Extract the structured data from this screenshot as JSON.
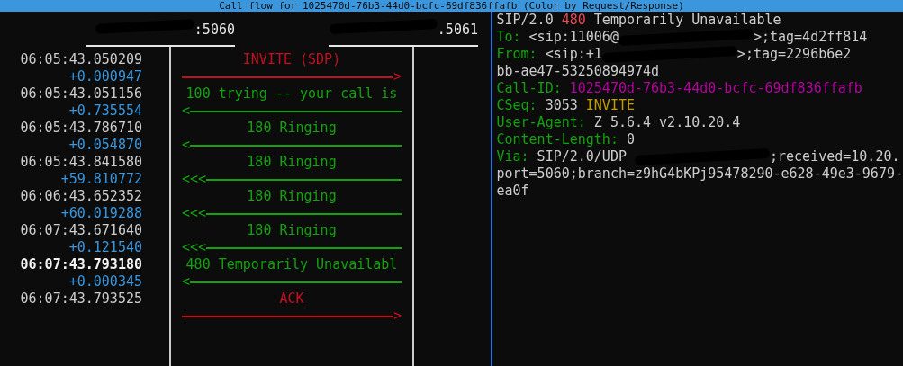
{
  "title": "Call flow for 1025470d-76b3-44d0-bcfc-69df836ffafb (Color by Request/Response)",
  "hosts": [
    {
      "label": ":5060"
    },
    {
      "label": ".5061"
    }
  ],
  "messages": [
    {
      "time": "06:05:43.050209",
      "delta": "+0.000947",
      "label": "INVITE (SDP)",
      "kind": "request",
      "to_right": true,
      "head": ">",
      "selected": false
    },
    {
      "time": "06:05:43.051156",
      "delta": "+0.735554",
      "label": "100 trying -- your call is",
      "kind": "response",
      "to_right": false,
      "head": "<",
      "selected": false
    },
    {
      "time": "06:05:43.786710",
      "delta": "+0.054870",
      "label": "180 Ringing",
      "kind": "response",
      "to_right": false,
      "head": "<",
      "selected": false
    },
    {
      "time": "06:05:43.841580",
      "delta": "+59.810772",
      "label": "180 Ringing",
      "kind": "response",
      "to_right": false,
      "head": "<<<",
      "selected": false
    },
    {
      "time": "06:06:43.652352",
      "delta": "+60.019288",
      "label": "180 Ringing",
      "kind": "response",
      "to_right": false,
      "head": "<<<",
      "selected": false
    },
    {
      "time": "06:07:43.671640",
      "delta": "+0.121540",
      "label": "180 Ringing",
      "kind": "response",
      "to_right": false,
      "head": "<<<",
      "selected": false
    },
    {
      "time": "06:07:43.793180",
      "delta": "+0.000345",
      "label": "480 Temporarily Unavailabl",
      "kind": "response",
      "to_right": false,
      "head": "<",
      "selected": true
    },
    {
      "time": "06:07:43.793525",
      "label": "ACK",
      "kind": "request",
      "to_right": true,
      "head": ">",
      "selected": false
    }
  ],
  "sip_lines": [
    [
      {
        "kind": "value",
        "text": "SIP/2.0 "
      },
      {
        "kind": "code",
        "text": "480"
      },
      {
        "kind": "value",
        "text": " Temporarily Unavailable"
      }
    ],
    [
      {
        "kind": "header",
        "text": "To: "
      },
      {
        "kind": "value",
        "text": "<sip:11006@"
      },
      {
        "kind": "redaction"
      },
      {
        "kind": "value",
        "text": ">;tag=4d2ff814"
      }
    ],
    [
      {
        "kind": "header",
        "text": "From: "
      },
      {
        "kind": "value",
        "text": "<sip:+1"
      },
      {
        "kind": "redaction"
      },
      {
        "kind": "value",
        "text": ">;tag=2296b6e2"
      }
    ],
    [
      {
        "kind": "value",
        "text": "bb-ae47-53250894974d"
      }
    ],
    [
      {
        "kind": "header",
        "text": "Call-ID: "
      },
      {
        "kind": "callid",
        "text": "1025470d-76b3-44d0-bcfc-69df836ffafb"
      }
    ],
    [
      {
        "kind": "header",
        "text": "CSeq: "
      },
      {
        "kind": "value",
        "text": "3053 "
      },
      {
        "kind": "method",
        "text": "INVITE"
      }
    ],
    [
      {
        "kind": "header",
        "text": "User-Agent: "
      },
      {
        "kind": "value",
        "text": "Z 5.6.4 v2.10.20.4"
      }
    ],
    [
      {
        "kind": "header",
        "text": "Content-Length: "
      },
      {
        "kind": "value",
        "text": "0"
      }
    ],
    [
      {
        "kind": "header",
        "text": "Via: "
      },
      {
        "kind": "value",
        "text": "SIP/2.0/UDP "
      },
      {
        "kind": "redaction"
      },
      {
        "kind": "value",
        "text": ";received=10.20."
      }
    ],
    [
      {
        "kind": "value",
        "text": "port=5060;branch=z9hG4bKPj95478290-e628-49e3-9679-"
      }
    ],
    [
      {
        "kind": "value",
        "text": "ea0f"
      }
    ]
  ]
}
